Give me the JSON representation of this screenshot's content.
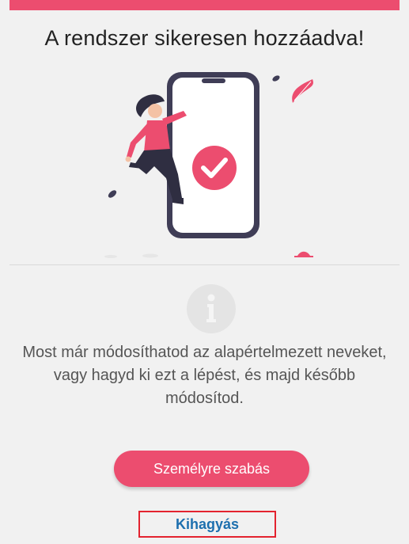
{
  "header": {
    "title": "A rendszer sikeresen hozzáadva!"
  },
  "message": {
    "text": "Most már módosíthatod az alapértelmezett neveket, vagy hagyd ki ezt a lépést, és majd később módosítod."
  },
  "actions": {
    "customize_label": "Személyre szabás",
    "skip_label": "Kihagyás"
  },
  "colors": {
    "accent": "#ec4d6f",
    "link": "#1d6fae",
    "highlight_border": "#e3232f"
  },
  "icons": {
    "success": "check-circle-icon",
    "info": "info-circle-icon"
  }
}
